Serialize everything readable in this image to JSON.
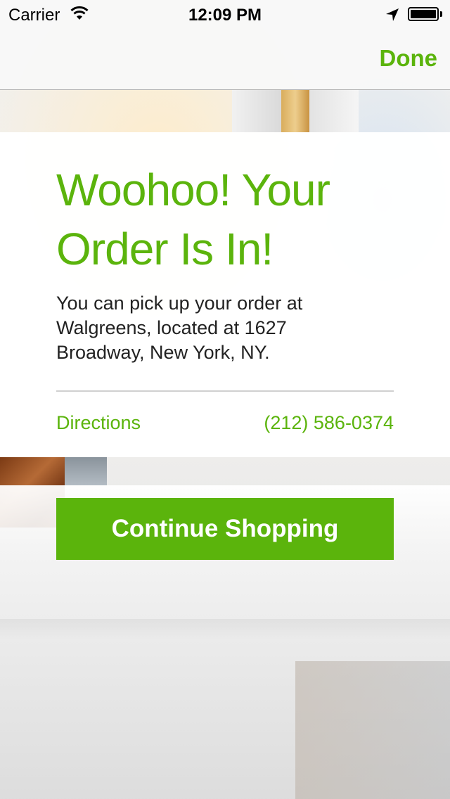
{
  "status_bar": {
    "carrier": "Carrier",
    "time": "12:09 PM",
    "icons": [
      "wifi-icon",
      "location-arrow-icon",
      "battery-icon"
    ],
    "battery_level": 1.0
  },
  "nav_bar": {
    "done_label": "Done"
  },
  "card": {
    "headline": "Woohoo! Your Order Is In!",
    "message": "You can pick up your order at Walgreens, located at 1627 Broadway, New York, NY.",
    "directions_label": "Directions",
    "phone": "(212) 586-0374"
  },
  "continue_button": {
    "label": "Continue Shopping"
  },
  "colors": {
    "accent": "#5bb40c",
    "text": "#222222",
    "card_bg": "#ffffff"
  }
}
